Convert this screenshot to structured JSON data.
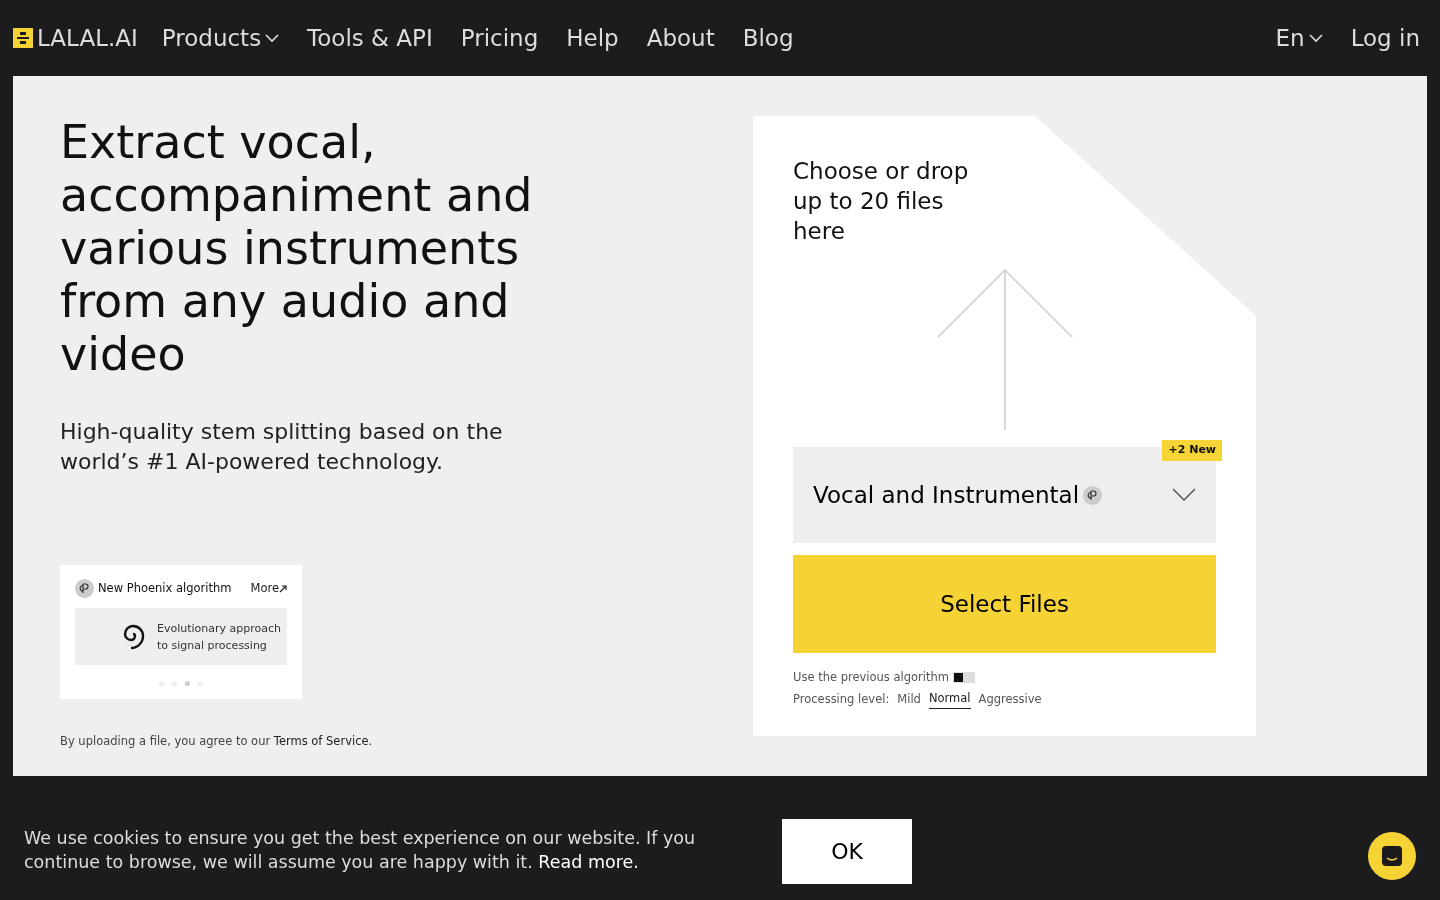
{
  "navbar": {
    "logo": "LALAL.AI",
    "items": [
      {
        "label": "Products",
        "dropdown": true
      },
      {
        "label": "Tools & API",
        "dropdown": false
      },
      {
        "label": "Pricing",
        "dropdown": false
      },
      {
        "label": "Help",
        "dropdown": false
      },
      {
        "label": "About",
        "dropdown": false
      },
      {
        "label": "Blog",
        "dropdown": false
      }
    ],
    "language": "En",
    "login": "Log in"
  },
  "hero": {
    "title": "Extract vocal, accompaniment and various instruments from any audio and video",
    "subtitle": "High-quality stem splitting based on the world’s #1 AI-powered technology."
  },
  "promo": {
    "title": "New Phoenix algorithm",
    "more": "More",
    "slide_line_1": "Evolutionary approach",
    "slide_line_2": "to signal processing",
    "dots": [
      {
        "selected": false
      },
      {
        "selected": false
      },
      {
        "selected": true
      },
      {
        "selected": false
      }
    ]
  },
  "terms": {
    "text": "By uploading a file, you agree to our ",
    "link": "Terms of Service."
  },
  "upload": {
    "prompt": "Choose or drop up to 20 files here",
    "stem": "Vocal and Instrumental",
    "badge": "+2 New",
    "button": "Select Files",
    "previous_algorithm": {
      "label": "Use the previous algorithm",
      "on": false
    },
    "level_label": "Processing level:",
    "levels": [
      {
        "label": "Mild",
        "selected": false
      },
      {
        "label": "Normal",
        "selected": true
      },
      {
        "label": "Aggressive",
        "selected": false
      }
    ]
  },
  "cookie": {
    "text": "We use cookies to ensure you get the best experience on our website. If you continue to browse, we will assume you are happy with it. ",
    "link": "Read more.",
    "ok": "OK"
  }
}
